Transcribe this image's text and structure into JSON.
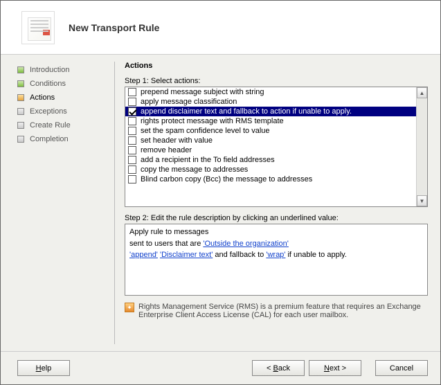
{
  "header": {
    "title": "New Transport Rule"
  },
  "sidebar": {
    "items": [
      {
        "label": "Introduction",
        "style": "green"
      },
      {
        "label": "Conditions",
        "style": "green"
      },
      {
        "label": "Actions",
        "style": "orange",
        "active": true
      },
      {
        "label": "Exceptions",
        "style": "grey"
      },
      {
        "label": "Create Rule",
        "style": "grey"
      },
      {
        "label": "Completion",
        "style": "grey"
      }
    ]
  },
  "main": {
    "heading": "Actions",
    "step1_label": "Step 1: Select actions:",
    "actions": [
      {
        "label": "prepend message subject with string",
        "checked": false
      },
      {
        "label": "apply message classification",
        "checked": false
      },
      {
        "label": "append disclaimer text and fallback to action if unable to apply.",
        "checked": true,
        "selected": true
      },
      {
        "label": "rights protect message with RMS template",
        "checked": false
      },
      {
        "label": "set the spam confidence level to value",
        "checked": false
      },
      {
        "label": "set header with value",
        "checked": false
      },
      {
        "label": "remove header",
        "checked": false
      },
      {
        "label": "add a recipient in the To field addresses",
        "checked": false
      },
      {
        "label": "copy the message to addresses",
        "checked": false
      },
      {
        "label": "Blind carbon copy (Bcc) the message to addresses",
        "checked": false
      }
    ],
    "step2_label": "Step 2: Edit the rule description by clicking an underlined value:",
    "description": {
      "line1": "Apply rule to messages",
      "line2a": "sent to users that are ",
      "line2_link": "'Outside the organization'",
      "line3_link1": "'append'",
      "line3_sep1": " ",
      "line3_link2": "'Disclaimer text'",
      "line3_mid": " and fallback to ",
      "line3_link3": "'wrap'",
      "line3_end": " if unable to apply."
    },
    "note": "Rights Management Service (RMS) is a premium feature that requires an Exchange Enterprise Client Access License (CAL) for each user mailbox."
  },
  "footer": {
    "help": "Help",
    "back": "Back",
    "next": "Next",
    "cancel": "Cancel"
  }
}
